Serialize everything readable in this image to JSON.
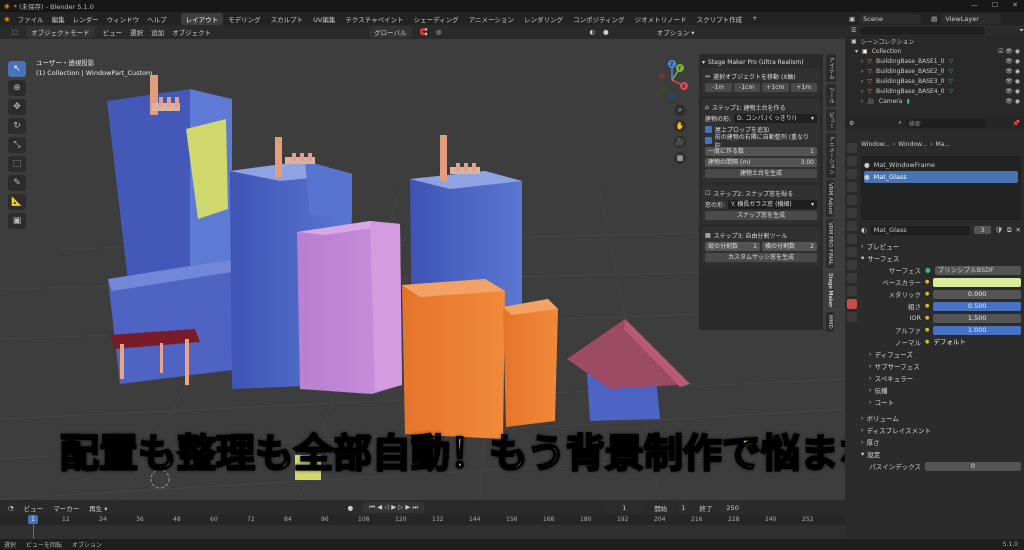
{
  "window": {
    "title": "* (未保存) - Blender 5.1.0",
    "controls": [
      "—",
      "☐",
      "✕"
    ]
  },
  "menu": {
    "items": [
      "ファイル",
      "編集",
      "レンダー",
      "ウィンドウ",
      "ヘルプ"
    ],
    "workspaces": [
      "レイアウト",
      "モデリング",
      "スカルプト",
      "UV編集",
      "テクスチャペイント",
      "シェーディング",
      "アニメーション",
      "レンダリング",
      "コンポジティング",
      "ジオメトリノード",
      "スクリプト作成"
    ],
    "active_workspace": "レイアウト",
    "add_tab": "+"
  },
  "topright": {
    "scene": "Scene",
    "viewlayer": "ViewLayer"
  },
  "viewport_header": {
    "mode": "オブジェクトモード",
    "items": [
      "ビュー",
      "選択",
      "追加",
      "オブジェクト"
    ],
    "transform": "グローバル",
    "options": "オプション ▾"
  },
  "viewport_info": {
    "line1": "ユーザー・透視投影",
    "line2": "(1) Collection | WindowPart_Custom"
  },
  "gizmo": {
    "x": "X",
    "y": "Y",
    "z": "Z"
  },
  "npanel": {
    "title": "Stage Maker Pro (Ultra Realism)",
    "move_label": "選択オブジェクトを移動 (X軸)",
    "move_buttons": [
      "-1m",
      "-1cm",
      "+1cm",
      "+1m"
    ],
    "step1": {
      "title": "ステップ1: 建物土台を作る",
      "shape_label": "建物の形:",
      "shape_value": "D. コンパ.(くっきり!)",
      "check1": "屋上プロップを追加",
      "check2": "前の建物の右隣に自動整列 (重なり防...",
      "count_label": "一度に作る数",
      "count_value": "1",
      "gap_label": "建物の間隔 (m)",
      "gap_value": "3.00",
      "button": "建物土台を生成"
    },
    "step2": {
      "title": "ステップ2: スナップ窓を貼る",
      "shape_label": "窓の形:",
      "shape_value": "Y. 横長ガラス窓 (横細)",
      "button": "スナップ窓を生成"
    },
    "step3": {
      "title": "ステップ3: 自由分割ツール",
      "vert_label": "縦の分割数",
      "vert_value": "1",
      "horiz_label": "横の分割数",
      "horiz_value": "2",
      "button": "カスタムサッシ窓を生成"
    }
  },
  "ntabs": [
    "アイテム",
    "ツール",
    "ビュー",
    "アニメーション",
    "VRM Adjust",
    "VRM PRO FINAL",
    "Stage Maker",
    "MMD"
  ],
  "caption": "配置も整理も全部自動！もう背景制作で悩まない",
  "timeline": {
    "items": [
      "ビュー",
      "マーカー",
      "再生 ▾"
    ],
    "frame": "1",
    "start_label": "開始",
    "start": "1",
    "end_label": "終了",
    "end": "250",
    "ticks": [
      "12",
      "24",
      "36",
      "48",
      "60",
      "72",
      "84",
      "96",
      "108",
      "120",
      "132",
      "144",
      "156",
      "168",
      "180",
      "192",
      "204",
      "216",
      "228",
      "240",
      "252"
    ],
    "current": "1"
  },
  "status": {
    "items": [
      "選択",
      "ビューを回転",
      "オプション"
    ],
    "version": "5.1.0"
  },
  "outliner": {
    "title": "シーンコレクション",
    "collection": "Collection",
    "rows": [
      "BuildingBase_BASE1_0",
      "BuildingBase_BASE2_0",
      "BuildingBase_BASE3_0",
      "BuildingBase_BASE4_0",
      "Camera"
    ]
  },
  "props": {
    "search": "検索",
    "breadcrumb": [
      "Window...",
      "Window...",
      "Ma..."
    ],
    "materials": [
      "Mat_WindowFrame",
      "Mat_Glass"
    ],
    "active_material": "Mat_Glass",
    "users": "3",
    "sections": {
      "preview": "プレビュー",
      "surface": "サーフェス"
    },
    "surface_label": "サーフェス",
    "surface_value": "プリンシプルBSDF",
    "rows": [
      {
        "label": "ベースカラー",
        "value": "",
        "kind": "color"
      },
      {
        "label": "メタリック",
        "value": "0.000",
        "kind": "plain"
      },
      {
        "label": "粗さ",
        "value": "0.500",
        "kind": "blue"
      },
      {
        "label": "IOR",
        "value": "1.500",
        "kind": "plain"
      },
      {
        "label": "アルファ",
        "value": "1.000",
        "kind": "blue"
      },
      {
        "label": "ノーマル",
        "value": "デフォルト",
        "kind": "plain"
      }
    ],
    "subsections": [
      "ディフューズ",
      "サブサーフェス",
      "スペキュラー",
      "伝播",
      "コート"
    ],
    "bottom_sections": [
      "ボリューム",
      "ディスプレイスメント",
      "厚さ",
      "設定"
    ],
    "pass_label": "パスインデックス",
    "pass_value": "0"
  },
  "colors": {
    "accent": "#4a72b8",
    "base_color": "#d8ec9a",
    "caption": "#ffe81a"
  }
}
